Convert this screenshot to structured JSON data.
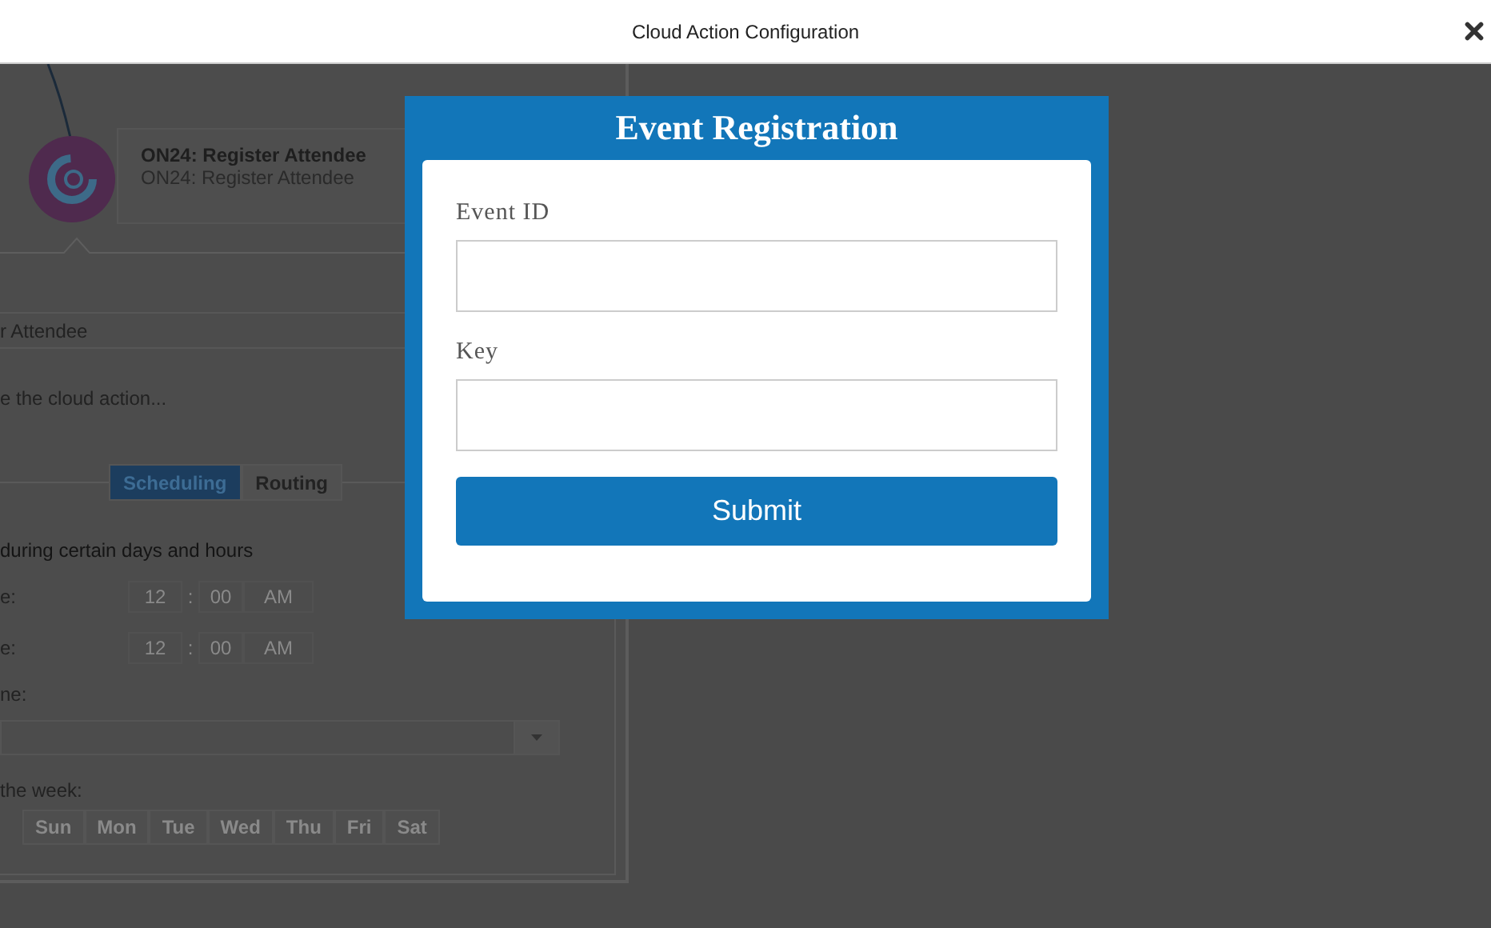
{
  "window": {
    "title": "Cloud Action Configuration"
  },
  "background": {
    "action_card": {
      "title": "ON24: Register Attendee",
      "subtitle": "ON24: Register Attendee"
    },
    "name_value": "r Attendee",
    "description": "e the cloud action...",
    "tabs": [
      {
        "label": "Scheduling",
        "selected": true
      },
      {
        "label": "Routing",
        "selected": false
      }
    ],
    "schedule_label": "during certain days and hours",
    "time_rows": [
      {
        "label": "e:",
        "hour": "12",
        "separator": ":",
        "minute": "00",
        "period": "AM"
      },
      {
        "label": "e:",
        "hour": "12",
        "separator": ":",
        "minute": "00",
        "period": "AM"
      }
    ],
    "timezone_label": "ne:",
    "weekdays_label": "the week:",
    "days": [
      "Sun",
      "Mon",
      "Tue",
      "Wed",
      "Thu",
      "Fri",
      "Sat"
    ]
  },
  "modal": {
    "title": "Event Registration",
    "fields": [
      {
        "label": "Event ID"
      },
      {
        "label": "Key"
      }
    ],
    "submit": "Submit"
  }
}
